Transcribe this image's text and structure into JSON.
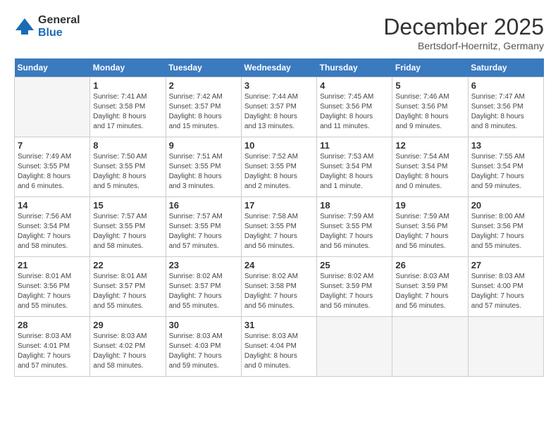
{
  "header": {
    "logo_general": "General",
    "logo_blue": "Blue",
    "month_title": "December 2025",
    "subtitle": "Bertsdorf-Hoernitz, Germany"
  },
  "days_of_week": [
    "Sunday",
    "Monday",
    "Tuesday",
    "Wednesday",
    "Thursday",
    "Friday",
    "Saturday"
  ],
  "weeks": [
    [
      {
        "day": "",
        "info": ""
      },
      {
        "day": "1",
        "info": "Sunrise: 7:41 AM\nSunset: 3:58 PM\nDaylight: 8 hours\nand 17 minutes."
      },
      {
        "day": "2",
        "info": "Sunrise: 7:42 AM\nSunset: 3:57 PM\nDaylight: 8 hours\nand 15 minutes."
      },
      {
        "day": "3",
        "info": "Sunrise: 7:44 AM\nSunset: 3:57 PM\nDaylight: 8 hours\nand 13 minutes."
      },
      {
        "day": "4",
        "info": "Sunrise: 7:45 AM\nSunset: 3:56 PM\nDaylight: 8 hours\nand 11 minutes."
      },
      {
        "day": "5",
        "info": "Sunrise: 7:46 AM\nSunset: 3:56 PM\nDaylight: 8 hours\nand 9 minutes."
      },
      {
        "day": "6",
        "info": "Sunrise: 7:47 AM\nSunset: 3:56 PM\nDaylight: 8 hours\nand 8 minutes."
      }
    ],
    [
      {
        "day": "7",
        "info": "Sunrise: 7:49 AM\nSunset: 3:55 PM\nDaylight: 8 hours\nand 6 minutes."
      },
      {
        "day": "8",
        "info": "Sunrise: 7:50 AM\nSunset: 3:55 PM\nDaylight: 8 hours\nand 5 minutes."
      },
      {
        "day": "9",
        "info": "Sunrise: 7:51 AM\nSunset: 3:55 PM\nDaylight: 8 hours\nand 3 minutes."
      },
      {
        "day": "10",
        "info": "Sunrise: 7:52 AM\nSunset: 3:55 PM\nDaylight: 8 hours\nand 2 minutes."
      },
      {
        "day": "11",
        "info": "Sunrise: 7:53 AM\nSunset: 3:54 PM\nDaylight: 8 hours\nand 1 minute."
      },
      {
        "day": "12",
        "info": "Sunrise: 7:54 AM\nSunset: 3:54 PM\nDaylight: 8 hours\nand 0 minutes."
      },
      {
        "day": "13",
        "info": "Sunrise: 7:55 AM\nSunset: 3:54 PM\nDaylight: 7 hours\nand 59 minutes."
      }
    ],
    [
      {
        "day": "14",
        "info": "Sunrise: 7:56 AM\nSunset: 3:54 PM\nDaylight: 7 hours\nand 58 minutes."
      },
      {
        "day": "15",
        "info": "Sunrise: 7:57 AM\nSunset: 3:55 PM\nDaylight: 7 hours\nand 58 minutes."
      },
      {
        "day": "16",
        "info": "Sunrise: 7:57 AM\nSunset: 3:55 PM\nDaylight: 7 hours\nand 57 minutes."
      },
      {
        "day": "17",
        "info": "Sunrise: 7:58 AM\nSunset: 3:55 PM\nDaylight: 7 hours\nand 56 minutes."
      },
      {
        "day": "18",
        "info": "Sunrise: 7:59 AM\nSunset: 3:55 PM\nDaylight: 7 hours\nand 56 minutes."
      },
      {
        "day": "19",
        "info": "Sunrise: 7:59 AM\nSunset: 3:56 PM\nDaylight: 7 hours\nand 56 minutes."
      },
      {
        "day": "20",
        "info": "Sunrise: 8:00 AM\nSunset: 3:56 PM\nDaylight: 7 hours\nand 55 minutes."
      }
    ],
    [
      {
        "day": "21",
        "info": "Sunrise: 8:01 AM\nSunset: 3:56 PM\nDaylight: 7 hours\nand 55 minutes."
      },
      {
        "day": "22",
        "info": "Sunrise: 8:01 AM\nSunset: 3:57 PM\nDaylight: 7 hours\nand 55 minutes."
      },
      {
        "day": "23",
        "info": "Sunrise: 8:02 AM\nSunset: 3:57 PM\nDaylight: 7 hours\nand 55 minutes."
      },
      {
        "day": "24",
        "info": "Sunrise: 8:02 AM\nSunset: 3:58 PM\nDaylight: 7 hours\nand 56 minutes."
      },
      {
        "day": "25",
        "info": "Sunrise: 8:02 AM\nSunset: 3:59 PM\nDaylight: 7 hours\nand 56 minutes."
      },
      {
        "day": "26",
        "info": "Sunrise: 8:03 AM\nSunset: 3:59 PM\nDaylight: 7 hours\nand 56 minutes."
      },
      {
        "day": "27",
        "info": "Sunrise: 8:03 AM\nSunset: 4:00 PM\nDaylight: 7 hours\nand 57 minutes."
      }
    ],
    [
      {
        "day": "28",
        "info": "Sunrise: 8:03 AM\nSunset: 4:01 PM\nDaylight: 7 hours\nand 57 minutes."
      },
      {
        "day": "29",
        "info": "Sunrise: 8:03 AM\nSunset: 4:02 PM\nDaylight: 7 hours\nand 58 minutes."
      },
      {
        "day": "30",
        "info": "Sunrise: 8:03 AM\nSunset: 4:03 PM\nDaylight: 7 hours\nand 59 minutes."
      },
      {
        "day": "31",
        "info": "Sunrise: 8:03 AM\nSunset: 4:04 PM\nDaylight: 8 hours\nand 0 minutes."
      },
      {
        "day": "",
        "info": ""
      },
      {
        "day": "",
        "info": ""
      },
      {
        "day": "",
        "info": ""
      }
    ]
  ]
}
